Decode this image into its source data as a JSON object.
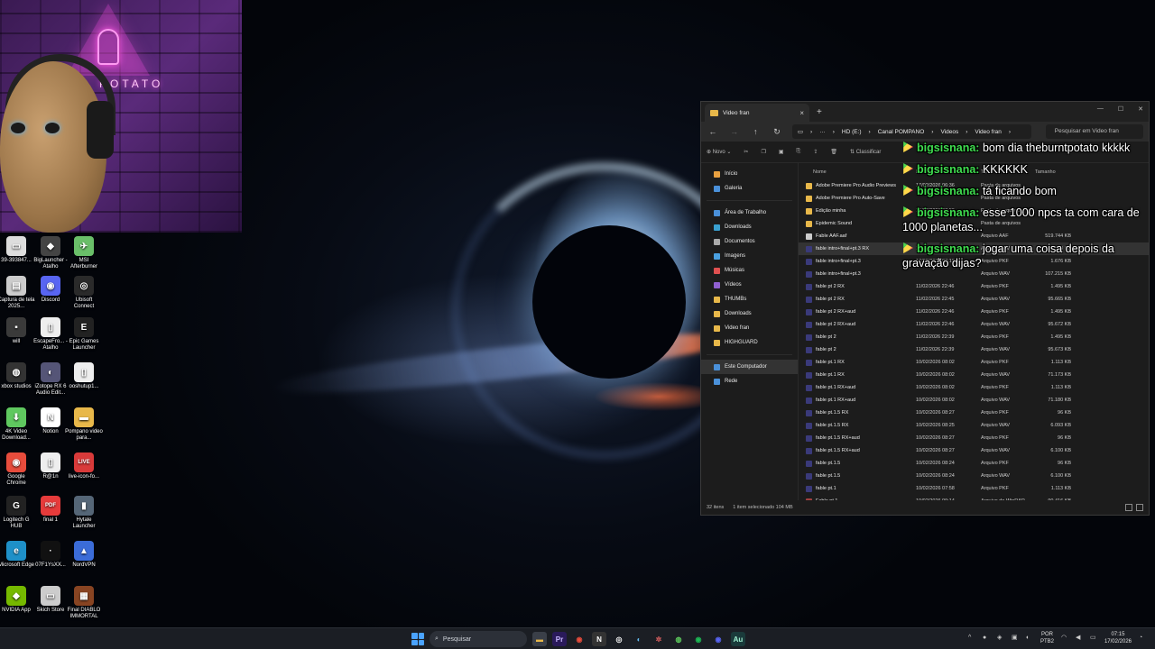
{
  "webcam": {
    "neon_text": "POTATO"
  },
  "desktop_icons": [
    {
      "label": "39-393847...",
      "color": "#dddddd",
      "glyph": "▭"
    },
    {
      "label": "BigLauncher - Atalho",
      "color": "#444444",
      "glyph": "◆"
    },
    {
      "label": "MSI Afterburner",
      "color": "#6abf69",
      "glyph": "✈"
    },
    {
      "label": "Captura de tela 2025...",
      "color": "#cccccc",
      "glyph": "▤"
    },
    {
      "label": "Discord",
      "color": "#5865f2",
      "glyph": "◉"
    },
    {
      "label": "Ubisoft Connect",
      "color": "#2a2a2a",
      "glyph": "◎"
    },
    {
      "label": "will",
      "color": "#3a3a3a",
      "glyph": "▪"
    },
    {
      "label": "EscapeFro... - Atalho",
      "color": "#eeeeee",
      "glyph": "▯"
    },
    {
      "label": "Epic Games Launcher",
      "color": "#222222",
      "glyph": "E"
    },
    {
      "label": "xbox studios",
      "color": "#333333",
      "glyph": "◍"
    },
    {
      "label": "iZotope RX 6 Audio Edit...",
      "color": "#555577",
      "glyph": "◐"
    },
    {
      "label": "ooshutup1...",
      "color": "#eeeeee",
      "glyph": "▯"
    },
    {
      "label": "4K Video Download...",
      "color": "#5fc85f",
      "glyph": "⬇"
    },
    {
      "label": "Notion",
      "color": "#ffffff",
      "glyph": "N"
    },
    {
      "label": "Pompano video para...",
      "color": "#e8b84a",
      "glyph": "▬"
    },
    {
      "label": "Google Chrome",
      "color": "#e74c3c",
      "glyph": "◉"
    },
    {
      "label": "R@1n",
      "color": "#eeeeee",
      "glyph": "▯"
    },
    {
      "label": "live-icon-fo...",
      "color": "#d93a3a",
      "glyph": "LIVE"
    },
    {
      "label": "Logitech G HUB",
      "color": "#222222",
      "glyph": "G"
    },
    {
      "label": "final 1",
      "color": "#e63b3b",
      "glyph": "PDF"
    },
    {
      "label": "Hytale Launcher",
      "color": "#556677",
      "glyph": "▮"
    },
    {
      "label": "Microsoft Edge",
      "color": "#1e90c8",
      "glyph": "e"
    },
    {
      "label": "07F1YsXX...",
      "color": "#111111",
      "glyph": "·"
    },
    {
      "label": "NordVPN",
      "color": "#3b6cd8",
      "glyph": "▲"
    },
    {
      "label": "NVIDIA App",
      "color": "#76b900",
      "glyph": "◆"
    },
    {
      "label": "Skich Store",
      "color": "#cccccc",
      "glyph": "▭"
    },
    {
      "label": "Final DIABLO IMMORTAL",
      "color": "#884422",
      "glyph": "▦"
    }
  ],
  "explorer": {
    "tab_title": "Video fran",
    "breadcrumbs": [
      "HD (E:)",
      "Canal POMPANO",
      "Videos",
      "Video fran"
    ],
    "search_placeholder": "Pesquisar em Video fran",
    "toolbar": {
      "new_label": "Novo",
      "sort_label": "Classificar"
    },
    "sidebar": [
      {
        "label": "Início",
        "color": "#e8a040"
      },
      {
        "label": "Galeria",
        "color": "#4a90d9"
      },
      {
        "sep": true
      },
      {
        "label": "Área de Trabalho",
        "color": "#4a90d9"
      },
      {
        "label": "Downloads",
        "color": "#3aa0d0"
      },
      {
        "label": "Documentos",
        "color": "#aaaaaa"
      },
      {
        "label": "Imagens",
        "color": "#4aa0e0"
      },
      {
        "label": "Músicas",
        "color": "#e05050"
      },
      {
        "label": "Vídeos",
        "color": "#9060d0"
      },
      {
        "label": "THUMBs",
        "color": "#e8b84a"
      },
      {
        "label": "Downloads",
        "color": "#e8b84a"
      },
      {
        "label": "Video fran",
        "color": "#e8b84a"
      },
      {
        "label": "HIGHGUARD",
        "color": "#e8b84a"
      },
      {
        "sep": true
      },
      {
        "label": "Este Computador",
        "color": "#4a90d9",
        "selected": true
      },
      {
        "label": "Rede",
        "color": "#4a90d9"
      }
    ],
    "columns": [
      "Nome",
      "Data de modificação",
      "Tipo",
      "Tamanho"
    ],
    "files": [
      {
        "name": "Adobe Premiere Pro Audio Previews",
        "date": "17/02/2026 06:36",
        "type": "Pasta de arquivos",
        "size": "",
        "kind": "folder"
      },
      {
        "name": "Adobe Premiere Pro Auto-Save",
        "date": "",
        "type": "Pasta de arquivos",
        "size": "",
        "kind": "folder"
      },
      {
        "name": "Edição minha",
        "date": "10/02/2026 07:59",
        "type": "Pasta de arquivos",
        "size": "",
        "kind": "folder"
      },
      {
        "name": "Epidemic Sound",
        "date": "",
        "type": "Pasta de arquivos",
        "size": "",
        "kind": "folder"
      },
      {
        "name": "Fable AAF.aaf",
        "date": "",
        "type": "Arquivo AAF",
        "size": "519.744 KB",
        "kind": "doc"
      },
      {
        "name": "fable intro+final+pt.3 RX",
        "date": "17/02/2026 07:14",
        "type": "Arquivo WAV",
        "size": "107.208 KB",
        "kind": "au",
        "selected": true
      },
      {
        "name": "fable intro+final+pt.3",
        "date": "17/02/2026 07:10",
        "type": "Arquivo PKF",
        "size": "1.676 KB",
        "kind": "au"
      },
      {
        "name": "fable intro+final+pt.3",
        "date": "",
        "type": "Arquivo WAV",
        "size": "107.215 KB",
        "kind": "au"
      },
      {
        "name": "fable pt 2 RX",
        "date": "11/02/2026 22:46",
        "type": "Arquivo PKF",
        "size": "1.495 KB",
        "kind": "au"
      },
      {
        "name": "fable pt 2 RX",
        "date": "11/02/2026 22:45",
        "type": "Arquivo WAV",
        "size": "95.665 KB",
        "kind": "au"
      },
      {
        "name": "fable pt 2 RX+aud",
        "date": "11/02/2026 22:46",
        "type": "Arquivo PKF",
        "size": "1.495 KB",
        "kind": "au"
      },
      {
        "name": "fable pt 2 RX+aud",
        "date": "11/02/2026 22:46",
        "type": "Arquivo WAV",
        "size": "95.672 KB",
        "kind": "au"
      },
      {
        "name": "fable pt 2",
        "date": "11/02/2026 22:39",
        "type": "Arquivo PKF",
        "size": "1.495 KB",
        "kind": "au"
      },
      {
        "name": "fable pt 2",
        "date": "11/02/2026 22:39",
        "type": "Arquivo WAV",
        "size": "95.673 KB",
        "kind": "au"
      },
      {
        "name": "fable pt.1 RX",
        "date": "10/02/2026 08:02",
        "type": "Arquivo PKF",
        "size": "1.113 KB",
        "kind": "au"
      },
      {
        "name": "fable pt.1 RX",
        "date": "10/02/2026 08:02",
        "type": "Arquivo WAV",
        "size": "71.173 KB",
        "kind": "au"
      },
      {
        "name": "fable pt.1 RX+aud",
        "date": "10/02/2026 08:02",
        "type": "Arquivo PKF",
        "size": "1.113 KB",
        "kind": "au"
      },
      {
        "name": "fable pt.1 RX+aud",
        "date": "10/02/2026 08:02",
        "type": "Arquivo WAV",
        "size": "71.180 KB",
        "kind": "au"
      },
      {
        "name": "fable pt.1.5 RX",
        "date": "10/02/2026 08:27",
        "type": "Arquivo PKF",
        "size": "96 KB",
        "kind": "au"
      },
      {
        "name": "fable pt.1.5 RX",
        "date": "10/02/2026 08:25",
        "type": "Arquivo WAV",
        "size": "6.093 KB",
        "kind": "au"
      },
      {
        "name": "fable pt.1.5 RX+aud",
        "date": "10/02/2026 08:27",
        "type": "Arquivo PKF",
        "size": "96 KB",
        "kind": "au"
      },
      {
        "name": "fable pt.1.5 RX+aud",
        "date": "10/02/2026 08:27",
        "type": "Arquivo WAV",
        "size": "6.100 KB",
        "kind": "au"
      },
      {
        "name": "fable pt.1.5",
        "date": "10/02/2026 08:24",
        "type": "Arquivo PKF",
        "size": "96 KB",
        "kind": "au"
      },
      {
        "name": "fable pt.1.5",
        "date": "10/02/2026 08:24",
        "type": "Arquivo WAV",
        "size": "6.100 KB",
        "kind": "au"
      },
      {
        "name": "fable pt.1",
        "date": "10/02/2026 07:58",
        "type": "Arquivo PKF",
        "size": "1.113 KB",
        "kind": "au"
      },
      {
        "name": "Fable pt.1",
        "date": "10/02/2026 09:14",
        "type": "Arquivo do WinRAR",
        "size": "90.416 KB",
        "kind": "rar"
      }
    ],
    "status": {
      "count": "32 itens",
      "selection": "1 item selecionado 104 MB"
    }
  },
  "chat": [
    {
      "user": "bigsisnana:",
      "text": "bom dia theburntpotato kkkkk"
    },
    {
      "user": "bigsisnana:",
      "text": "KKKKKK"
    },
    {
      "user": "bigsisnana:",
      "text": "tá ficando bom"
    },
    {
      "user": "bigsisnana:",
      "text": "esse 1000 npcs ta com cara de 1000 planetas..."
    },
    {
      "user": "bigsisnana:",
      "text": "jogar uma coisa depois da gravação dijas?"
    }
  ],
  "taskbar": {
    "search_label": "Pesquisar",
    "apps": [
      {
        "name": "file-explorer",
        "glyph": "▬",
        "color": "#e8b84a",
        "bg": "transparent",
        "active": true
      },
      {
        "name": "premiere-pro",
        "glyph": "Pr",
        "color": "#c8b8ff",
        "bg": "#2a1a5a",
        "active": false
      },
      {
        "name": "chrome",
        "glyph": "◉",
        "color": "#e74c3c",
        "bg": "transparent",
        "active": false
      },
      {
        "name": "notion",
        "glyph": "N",
        "color": "#ffffff",
        "bg": "#333333",
        "active": false
      },
      {
        "name": "obs",
        "glyph": "◎",
        "color": "#ffffff",
        "bg": "transparent",
        "active": false
      },
      {
        "name": "steam",
        "glyph": "◐",
        "color": "#66c0f4",
        "bg": "transparent",
        "active": false
      },
      {
        "name": "davinci",
        "glyph": "✲",
        "color": "#d96060",
        "bg": "transparent",
        "active": false
      },
      {
        "name": "xbox",
        "glyph": "◍",
        "color": "#5fd05f",
        "bg": "transparent",
        "active": false
      },
      {
        "name": "spotify",
        "glyph": "◉",
        "color": "#1db954",
        "bg": "transparent",
        "active": false
      },
      {
        "name": "discord",
        "glyph": "◉",
        "color": "#5865f2",
        "bg": "transparent",
        "active": false
      },
      {
        "name": "audition",
        "glyph": "Au",
        "color": "#9ff0d0",
        "bg": "#1a3a3a",
        "active": true
      }
    ],
    "lang_top": "POR",
    "lang_bottom": "PTB2",
    "time": "07:15",
    "date": "17/02/2026"
  }
}
